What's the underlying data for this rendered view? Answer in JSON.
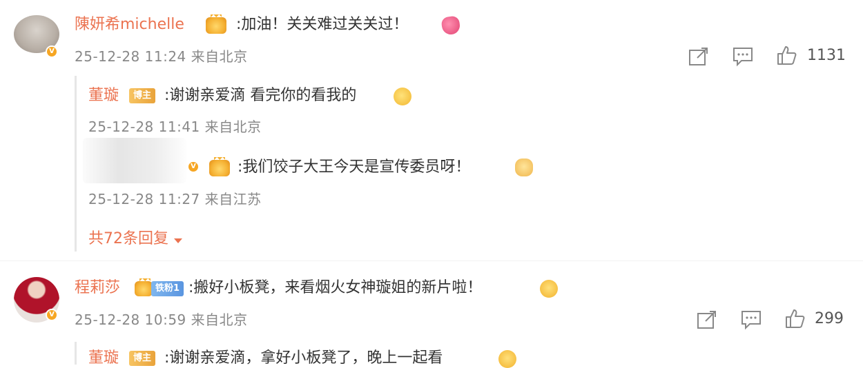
{
  "comments": [
    {
      "user": "陳妍希michelle",
      "text": ":加油！关关难过关关过！",
      "meta": "25-12-28 11:24 来自北京",
      "likes": "1131",
      "replies": [
        {
          "user": "董璇",
          "badge": "博主",
          "text": ":谢谢亲爱滴 看完你的看我的",
          "meta": "25-12-28 11:41 来自北京"
        },
        {
          "user": "",
          "text": ":我们饺子大王今天是宣传委员呀！",
          "meta": "25-12-28 11:27 来自江苏"
        }
      ],
      "more_replies": "共72条回复"
    },
    {
      "user": "程莉莎",
      "badge": "铁粉1",
      "text": ":搬好小板凳，来看烟火女神璇姐的新片啦！",
      "meta": "25-12-28 10:59 来自北京",
      "likes": "299",
      "replies": [
        {
          "user": "董璇",
          "badge": "博主",
          "text": ":谢谢亲爱滴，拿好小板凳了，晚上一起看"
        }
      ]
    }
  ],
  "icons": {
    "forward": "share-icon",
    "comment": "comment-icon",
    "like": "thumbs-up-icon",
    "more": "caret-down-icon"
  },
  "colors": {
    "username": "#eb7350",
    "text": "#333333",
    "meta": "#888888",
    "verified": "#f6a623"
  }
}
